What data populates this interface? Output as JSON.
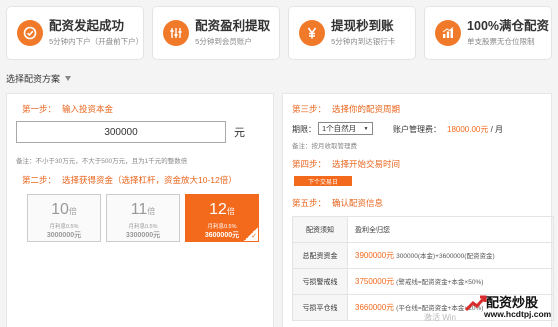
{
  "features": [
    {
      "title": "配资发起成功",
      "sub": "5分钟内下户（开盘前下户）",
      "icon": "clock-check-icon"
    },
    {
      "title": "配资盈利提取",
      "sub": "5分钟到会员账户",
      "icon": "sliders-icon"
    },
    {
      "title": "提现秒到账",
      "sub": "5分钟内到达银行卡",
      "icon": "yen-icon"
    },
    {
      "title": "100%满仓配资",
      "sub": "单支股票无仓位限制",
      "icon": "bar-chart-icon"
    }
  ],
  "section_title": "选择配资方案",
  "step1": {
    "label": "第一步：",
    "text": "输入投资本金",
    "value": "300000",
    "unit": "元",
    "note": "备注：不小于30万元，不大于500万元，且为1千元的整数倍"
  },
  "step2": {
    "label": "第二步：",
    "text": "选择获得资金（选择杠杆，资金放大10-12倍）"
  },
  "leverage": [
    {
      "num": "10",
      "unit": "倍",
      "rate": "月利息0.5%",
      "total": "3000000元",
      "active": false
    },
    {
      "num": "11",
      "unit": "倍",
      "rate": "月利息0.5%",
      "total": "3300000元",
      "active": false
    },
    {
      "num": "12",
      "unit": "倍",
      "rate": "月利息0.5%",
      "total": "3600000元",
      "active": true
    }
  ],
  "step3": {
    "label": "第三步：",
    "text": "选择你的配资周期",
    "period_label": "期限：",
    "period_value": "1个自然月",
    "fee_label": "账户管理费：",
    "fee_value": "18000.00元",
    "fee_unit": "/ 月",
    "note": "备注：按月收取管理费"
  },
  "step4": {
    "label": "第四步：",
    "text": "选择开始交易时间",
    "button": "下个交易日"
  },
  "step5": {
    "label": "第五步：",
    "text": "确认配资信息"
  },
  "info_rows": [
    {
      "key": "配资须知",
      "value": "盈利全归您",
      "desc": "",
      "highlight": false
    },
    {
      "key": "总配资资金",
      "value": "3900000元",
      "desc": "300000(本金)+3600000(配资资金)",
      "highlight": true
    },
    {
      "key": "亏损警戒线",
      "value": "3750000元",
      "desc": "(警戒线=配资资金+本金×50%)",
      "highlight": true
    },
    {
      "key": "亏损平仓线",
      "value": "3660000元",
      "desc": "(平仓线=配资资金+本金×20%)",
      "highlight": true
    }
  ],
  "logo": {
    "name": "配资炒股",
    "url": "www.hcdtpj.com"
  },
  "watermark": "激活 Win"
}
